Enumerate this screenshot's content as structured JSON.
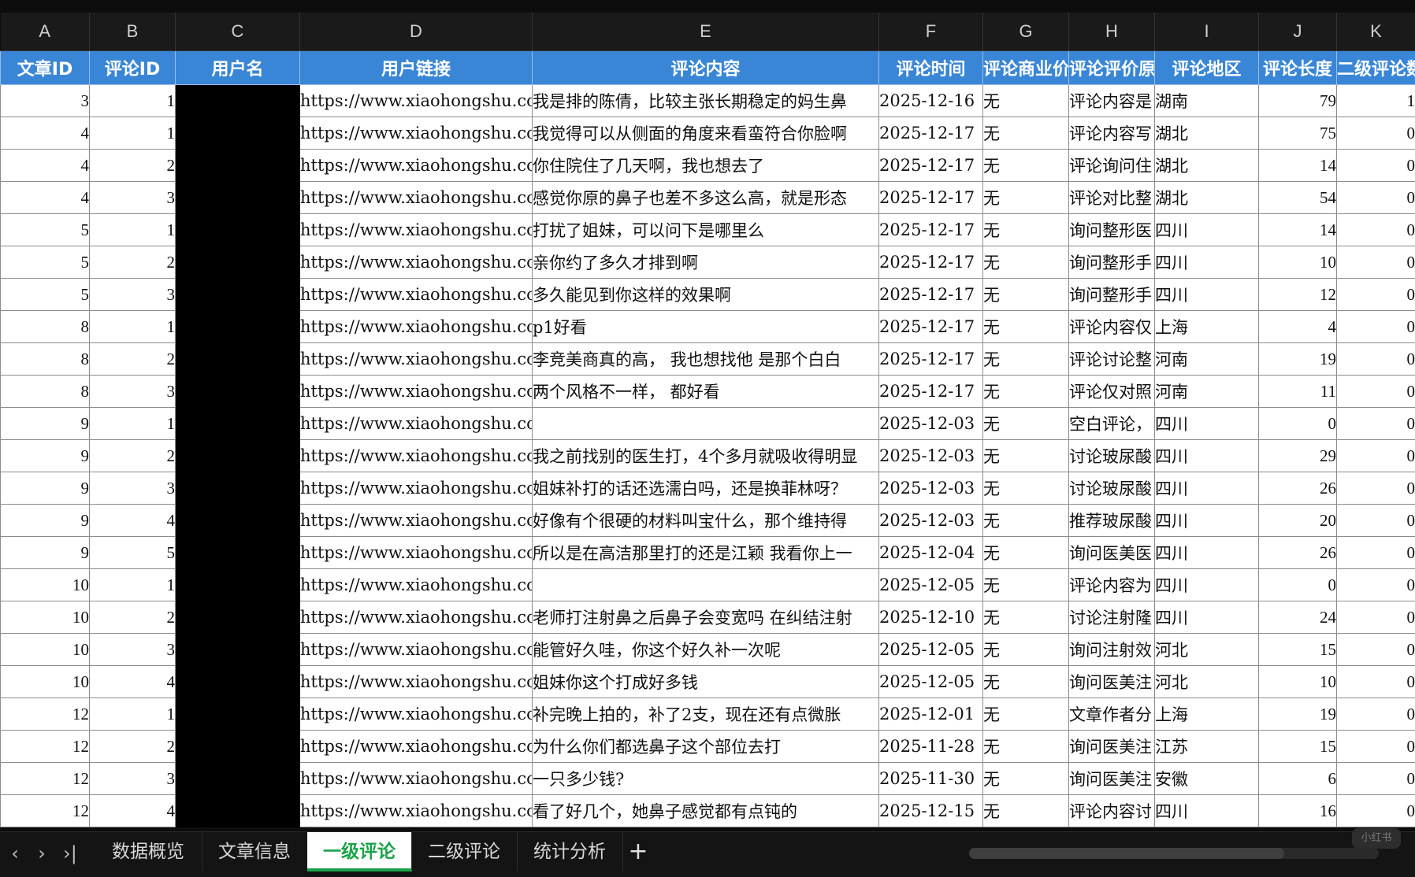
{
  "columns": [
    "A",
    "B",
    "C",
    "D",
    "E",
    "F",
    "G",
    "H",
    "I",
    "J",
    "K"
  ],
  "headers": [
    "文章ID",
    "评论ID",
    "用户名",
    "用户链接",
    "评论内容",
    "评论时间",
    "评论商业价值",
    "评论评价原因",
    "评论地区",
    "评论长度",
    "二级评论数"
  ],
  "rows": [
    [
      "3",
      "1",
      "",
      "https://www.xiaohongshu.com",
      "我是排的陈倩，比较主张长期稳定的妈生鼻",
      "2025-12-16",
      "无",
      "评论内容是",
      "湖南",
      "79",
      "1"
    ],
    [
      "4",
      "1",
      "",
      "https://www.xiaohongshu.com",
      "我觉得可以从侧面的角度来看蛮符合你脸啊",
      "2025-12-17",
      "无",
      "评论内容写",
      "湖北",
      "75",
      "0"
    ],
    [
      "4",
      "2",
      "",
      "https://www.xiaohongshu.com",
      "你住院住了几天啊，我也想去了",
      "2025-12-17",
      "无",
      "评论询问住",
      "湖北",
      "14",
      "0"
    ],
    [
      "4",
      "3",
      "",
      "https://www.xiaohongshu.com",
      "感觉你原的鼻子也差不多这么高，就是形态",
      "2025-12-17",
      "无",
      "评论对比整",
      "湖北",
      "54",
      "0"
    ],
    [
      "5",
      "1",
      "",
      "https://www.xiaohongshu.com",
      "打扰了姐妹，可以问下是哪里么",
      "2025-12-17",
      "无",
      "询问整形医",
      "四川",
      "14",
      "0"
    ],
    [
      "5",
      "2",
      "",
      "https://www.xiaohongshu.com",
      "亲你约了多久才排到啊",
      "2025-12-17",
      "无",
      "询问整形手",
      "四川",
      "10",
      "0"
    ],
    [
      "5",
      "3",
      "",
      "https://www.xiaohongshu.com",
      "多久能见到你这样的效果啊",
      "2025-12-17",
      "无",
      "询问整形手",
      "四川",
      "12",
      "0"
    ],
    [
      "8",
      "1",
      "",
      "https://www.xiaohongshu.com",
      "p1好看",
      "2025-12-17",
      "无",
      "评论内容仅",
      "上海",
      "4",
      "0"
    ],
    [
      "8",
      "2",
      "",
      "https://www.xiaohongshu.com",
      "李竞美商真的高， 我也想找他 是那个白白",
      "2025-12-17",
      "无",
      "评论讨论整",
      "河南",
      "19",
      "0"
    ],
    [
      "8",
      "3",
      "",
      "https://www.xiaohongshu.com",
      "两个风格不一样， 都好看",
      "2025-12-17",
      "无",
      "评论仅对照",
      "河南",
      "11",
      "0"
    ],
    [
      "9",
      "1",
      "",
      "https://www.xiaohongshu.com",
      "",
      "2025-12-03",
      "无",
      "空白评论，",
      "四川",
      "0",
      "0"
    ],
    [
      "9",
      "2",
      "",
      "https://www.xiaohongshu.com",
      "我之前找别的医生打，4个多月就吸收得明显",
      "2025-12-03",
      "无",
      "讨论玻尿酸",
      "四川",
      "29",
      "0"
    ],
    [
      "9",
      "3",
      "",
      "https://www.xiaohongshu.com",
      "姐妹补打的话还选濡白吗，还是换菲林呀？",
      "2025-12-03",
      "无",
      "讨论玻尿酸",
      "四川",
      "26",
      "0"
    ],
    [
      "9",
      "4",
      "",
      "https://www.xiaohongshu.com",
      "好像有个很硬的材料叫宝什么，那个维持得",
      "2025-12-03",
      "无",
      "推荐玻尿酸",
      "四川",
      "20",
      "0"
    ],
    [
      "9",
      "5",
      "",
      "https://www.xiaohongshu.com",
      "所以是在高洁那里打的还是江颖 我看你上一",
      "2025-12-04",
      "无",
      "询问医美医",
      "四川",
      "26",
      "0"
    ],
    [
      "10",
      "1",
      "",
      "https://www.xiaohongshu.com",
      "",
      "2025-12-05",
      "无",
      "评论内容为",
      "四川",
      "0",
      "0"
    ],
    [
      "10",
      "2",
      "",
      "https://www.xiaohongshu.com",
      "老师打注射鼻之后鼻子会变宽吗 在纠结注射",
      "2025-12-10",
      "无",
      "讨论注射隆",
      "四川",
      "24",
      "0"
    ],
    [
      "10",
      "3",
      "",
      "https://www.xiaohongshu.com",
      "能管好久哇，你这个好久补一次呢",
      "2025-12-05",
      "无",
      "询问注射效",
      "河北",
      "15",
      "0"
    ],
    [
      "10",
      "4",
      "",
      "https://www.xiaohongshu.com",
      "姐妹你这个打成好多钱",
      "2025-12-05",
      "无",
      "询问医美注",
      "河北",
      "10",
      "0"
    ],
    [
      "12",
      "1",
      "",
      "https://www.xiaohongshu.com",
      "补完晚上拍的，补了2支，现在还有点微胀",
      "2025-12-01",
      "无",
      "文章作者分",
      "上海",
      "19",
      "0"
    ],
    [
      "12",
      "2",
      "",
      "https://www.xiaohongshu.com",
      "为什么你们都选鼻子这个部位去打",
      "2025-11-28",
      "无",
      "询问医美注",
      "江苏",
      "15",
      "0"
    ],
    [
      "12",
      "3",
      "",
      "https://www.xiaohongshu.com",
      "一只多少钱?",
      "2025-11-30",
      "无",
      "询问医美注",
      "安徽",
      "6",
      "0"
    ],
    [
      "12",
      "4",
      "",
      "https://www.xiaohongshu.com",
      "看了好几个，她鼻子感觉都有点钝的",
      "2025-12-15",
      "无",
      "评论内容讨",
      "四川",
      "16",
      "0"
    ]
  ],
  "tabs": [
    "数据概览",
    "文章信息",
    "一级评论",
    "二级评论",
    "统计分析"
  ],
  "active_tab": "一级评论",
  "add_tab": "+",
  "nav": {
    "prev": "‹",
    "next": "›",
    "last": "›|"
  },
  "watermark": "小红书"
}
